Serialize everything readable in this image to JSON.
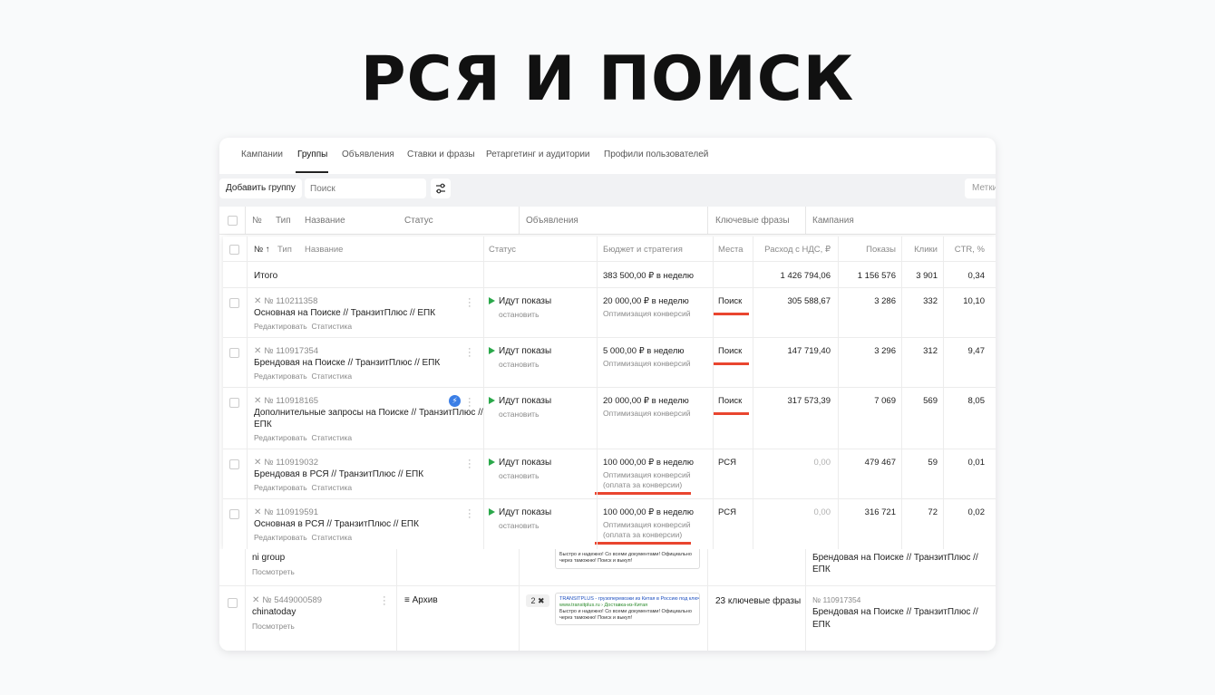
{
  "headline": "РСЯ И ПОИСК",
  "tabs": [
    {
      "label": "Кампании"
    },
    {
      "label": "Группы",
      "active": true
    },
    {
      "label": "Объявления"
    },
    {
      "label": "Ставки и фразы"
    },
    {
      "label": "Ретаргетинг и аудитории"
    },
    {
      "label": "Профили пользователей"
    }
  ],
  "toolbar": {
    "add_group": "Добавить группу",
    "search_placeholder": "Поиск",
    "labels": "Метки"
  },
  "back_header": {
    "no": "№",
    "type": "Тип",
    "name": "Название",
    "status": "Статус",
    "ads": "Объявления",
    "keywords": "Ключевые фразы",
    "campaign": "Кампания"
  },
  "table": {
    "headers": {
      "no": "№ ↑",
      "type": "Тип",
      "name": "Название",
      "status": "Статус",
      "budget": "Бюджет и стратегия",
      "places": "Места",
      "spend": "Расход с НДС, ₽",
      "shows": "Показы",
      "clicks": "Клики",
      "ctr": "CTR, %"
    },
    "total": {
      "label": "Итого",
      "budget": "383 500,00 ₽ в неделю",
      "spend": "1 426 794,06",
      "shows": "1 156 576",
      "clicks": "3 901",
      "ctr": "0,34"
    },
    "row_links": {
      "edit": "Редактировать",
      "stats": "Статистика"
    },
    "rows": [
      {
        "id": "№ 110211358",
        "name": "Основная на Поиске // ТранзитПлюс // ЕПК",
        "name2": "",
        "status": "Идут показы",
        "stop": "остановить",
        "budget": "20 000,00 ₽ в неделю",
        "strategy": "Оптимизация конверсий",
        "strategy2": "",
        "place": "Поиск",
        "spend": "305 588,67",
        "shows": "3 286",
        "clicks": "332",
        "ctr": "10,10"
      },
      {
        "id": "№ 110917354",
        "name": "Брендовая на Поиске // ТранзитПлюс // ЕПК",
        "name2": "",
        "status": "Идут показы",
        "stop": "остановить",
        "budget": "5 000,00 ₽ в неделю",
        "strategy": "Оптимизация конверсий",
        "strategy2": "",
        "place": "Поиск",
        "spend": "147 719,40",
        "shows": "3 296",
        "clicks": "312",
        "ctr": "9,47"
      },
      {
        "id": "№ 110918165",
        "name": "Дополнительные запросы на Поиске // ТранзитПлюс //",
        "name2": "ЕПК",
        "status": "Идут показы",
        "stop": "остановить",
        "budget": "20 000,00 ₽ в неделю",
        "strategy": "Оптимизация конверсий",
        "strategy2": "",
        "place": "Поиск",
        "spend": "317 573,39",
        "shows": "7 069",
        "clicks": "569",
        "ctr": "8,05"
      },
      {
        "id": "№ 110919032",
        "name": "Брендовая в РСЯ // ТранзитПлюс // ЕПК",
        "name2": "",
        "status": "Идут показы",
        "stop": "остановить",
        "budget": "100 000,00 ₽ в неделю",
        "strategy": "Оптимизация конверсий",
        "strategy2": "(оплата за конверсии)",
        "place": "РСЯ",
        "spend": "0,00",
        "shows": "479 467",
        "clicks": "59",
        "ctr": "0,01"
      },
      {
        "id": "№ 110919591",
        "name": "Основная в РСЯ // ТранзитПлюс // ЕПК",
        "name2": "",
        "status": "Идут показы",
        "stop": "остановить",
        "budget": "100 000,00 ₽ в неделю",
        "strategy": "Оптимизация конверсий",
        "strategy2": "(оплата за конверсии)",
        "place": "РСЯ",
        "spend": "0,00",
        "shows": "316 721",
        "clicks": "72",
        "ctr": "0,02"
      }
    ]
  },
  "lower": {
    "partial": {
      "name": "ni group",
      "view": "Посмотреть",
      "ad_l1": "Быстро и надежно! Со всеми документами! Официально",
      "ad_l2": "через таможню! Поиск и выкуп!",
      "campaign_l1": "Брендовая на Поиске // ТранзитПлюс //",
      "campaign_l2": "ЕПК"
    },
    "row": {
      "id": "№ 5449000589",
      "name": "chinatoday",
      "view": "Посмотреть",
      "status": "Архив",
      "ad_count": "2",
      "ad_title": "TRANSITPLUS - грузоперевозки из Китая в Россию под ключ!",
      "ad_url": "www.transitplus.ru › Доставка-из-Китая",
      "ad_l1": "Быстро и надежно! Со всеми документами! Официально",
      "ad_l2": "через таможню! Поиск и выкуп!",
      "keywords": "23 ключевые фразы",
      "campaign_id": "№ 110917354",
      "campaign_l1": "Брендовая на Поиске // ТранзитПлюс //",
      "campaign_l2": "ЕПК"
    }
  },
  "colors": {
    "accent_line": "#e9452f",
    "play": "#2aa84a",
    "bolt": "#3a7ee6"
  }
}
